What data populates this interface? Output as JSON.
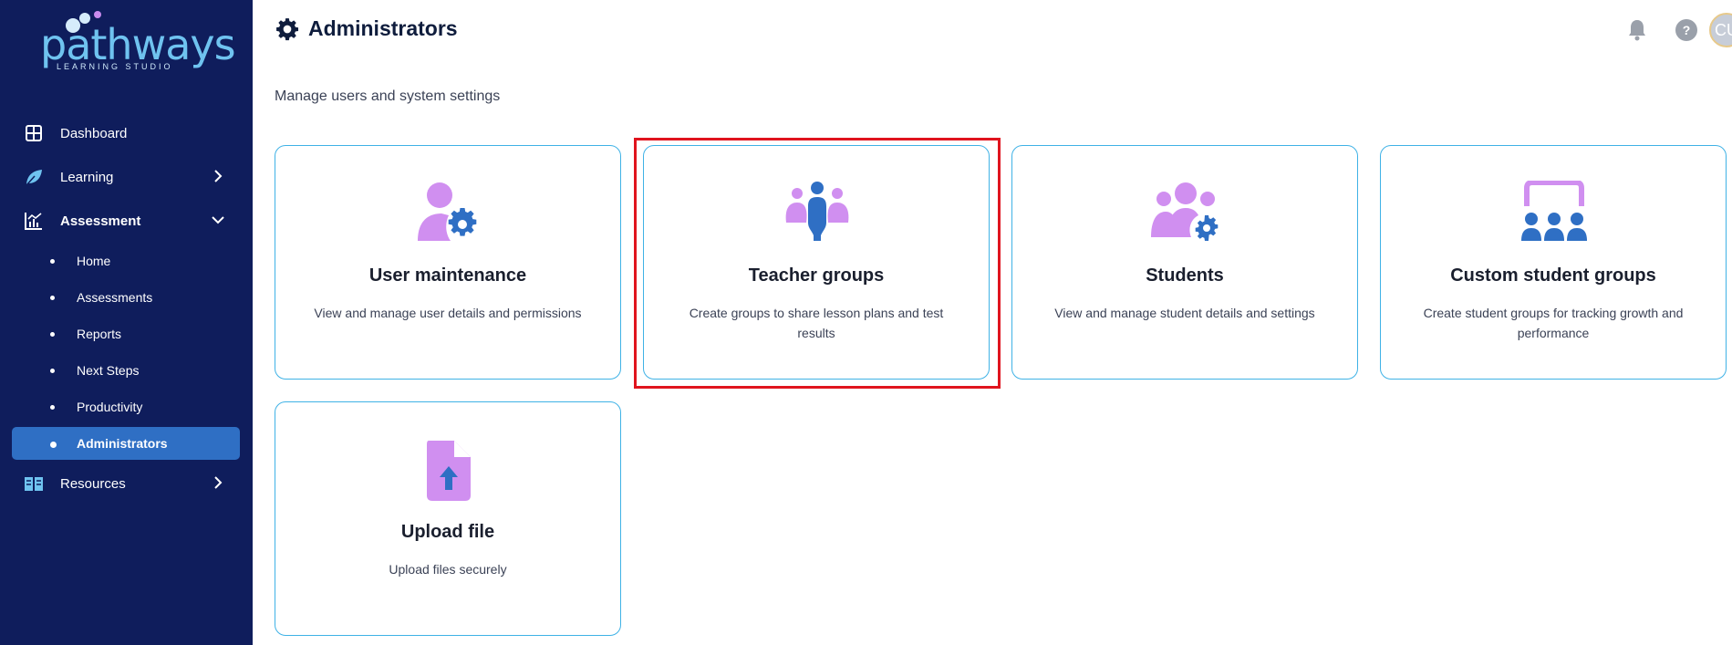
{
  "brand": {
    "name": "pathways",
    "tagline": "LEARNING STUDIO"
  },
  "sidebar": {
    "items": [
      {
        "label": "Dashboard"
      },
      {
        "label": "Learning"
      },
      {
        "label": "Assessment"
      },
      {
        "label": "Resources"
      }
    ],
    "subitems": [
      {
        "label": "Home"
      },
      {
        "label": "Assessments"
      },
      {
        "label": "Reports"
      },
      {
        "label": "Next Steps"
      },
      {
        "label": "Productivity"
      },
      {
        "label": "Administrators"
      }
    ]
  },
  "header": {
    "title": "Administrators",
    "subtitle": "Manage users and system settings",
    "help": "?",
    "avatar_initials": "CU"
  },
  "cards": [
    {
      "title": "User maintenance",
      "description": "View and manage user details and permissions",
      "icon": "user-gear-icon"
    },
    {
      "title": "Teacher groups",
      "description": "Create groups to share lesson plans and test results",
      "icon": "teacher-group-icon"
    },
    {
      "title": "Students",
      "description": "View and manage student details and settings",
      "icon": "students-gear-icon"
    },
    {
      "title": "Custom student groups",
      "description": "Create student groups for tracking growth and performance",
      "icon": "custom-group-icon"
    },
    {
      "title": "Upload file",
      "description": "Upload files securely",
      "icon": "file-upload-icon"
    }
  ],
  "colors": {
    "sidebar": "#0f1d5c",
    "active": "#2f6fc4",
    "accent_purple": "#d08ff0",
    "accent_blue": "#2f6fc4",
    "card_border": "#3fb2e6",
    "highlight": "#e0141e"
  }
}
